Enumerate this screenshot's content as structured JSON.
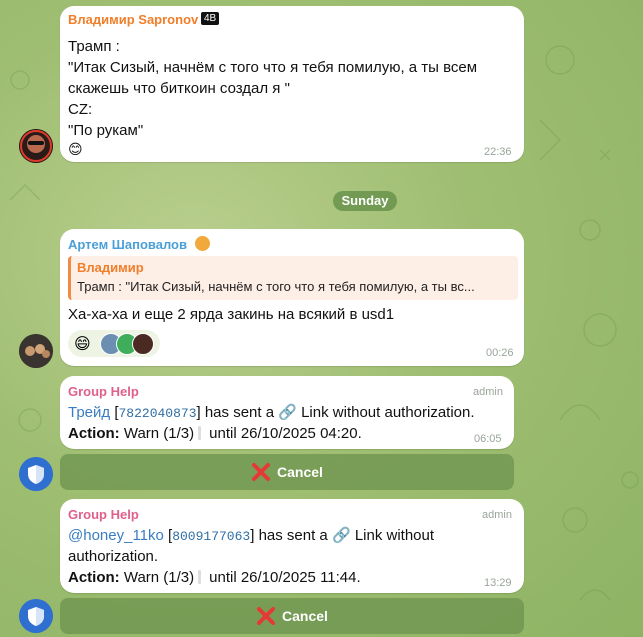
{
  "messages": [
    {
      "sender": "Владимир Sapronov",
      "badge": "4B",
      "lines": [
        "Трамп :",
        "\"Итак Сизый, начнём с того что я тебя помилую, а ты всем",
        "скажешь что биткоин создал я \"",
        "CZ:",
        "\"По рукам\""
      ],
      "emoji": "😊",
      "time": "22:36"
    },
    {
      "date": "Sunday"
    },
    {
      "sender": "Артем Шаповалов",
      "reply_to": {
        "sender": "Владимир",
        "text": "Трамп : \"Итак Сизый, начнём с того что я тебя помилую, а ты вс..."
      },
      "text": "Ха-ха-ха и еще 2 ярда закинь на всякий в usd1",
      "reaction_emoji": "😄",
      "time": "00:26"
    },
    {
      "sender": "Group Help",
      "role": "admin",
      "user": "Трейд",
      "user_id": "7822040873",
      "text_after": "has sent a",
      "link_text": "Link without authorization.",
      "action_label": "Action:",
      "action_value": "Warn (1/3)",
      "until": "until 26/10/2025 04:20.",
      "time": "06:05",
      "button": "Cancel"
    },
    {
      "sender": "Group Help",
      "role": "admin",
      "user": "@honey_11ko",
      "user_id": "8009177063",
      "text_after": "has sent a",
      "link_text_1": "Link without",
      "link_text_2": "authorization.",
      "action_label": "Action:",
      "action_value": "Warn (1/3)",
      "until": "until 26/10/2025 11:44.",
      "time": "13:29",
      "button": "Cancel"
    }
  ],
  "colors": {
    "sender_orange": "#f07e2a",
    "sender_blue": "#4a9fd8",
    "sender_pink": "#e0608c",
    "cancel_red": "#e53935"
  }
}
